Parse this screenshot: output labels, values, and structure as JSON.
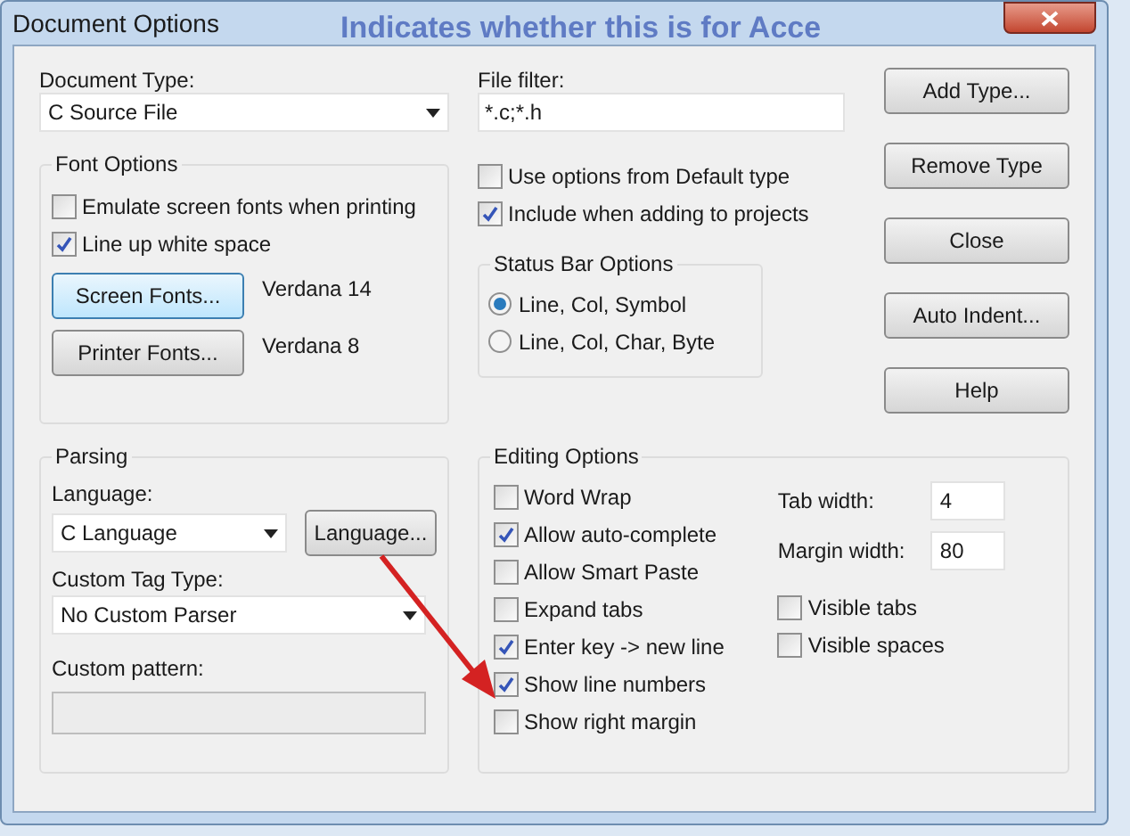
{
  "window": {
    "title": "Document Options",
    "background_text": "Indicates whether this is for Acce"
  },
  "document_type": {
    "label": "Document Type:",
    "value": "C Source File"
  },
  "file_filter": {
    "label": "File filter:",
    "value": "*.c;*.h"
  },
  "font_options": {
    "title": "Font Options",
    "checkboxes": [
      {
        "label": "Emulate screen fonts when printing",
        "checked": false
      },
      {
        "label": "Line up white space",
        "checked": true
      }
    ],
    "fonts": [
      {
        "button": "Screen Fonts...",
        "value": "Verdana 14",
        "focused": true
      },
      {
        "button": "Printer Fonts...",
        "value": "Verdana 8",
        "focused": false
      }
    ]
  },
  "type_options": [
    {
      "label": "Use options from Default type",
      "checked": false
    },
    {
      "label": "Include when adding to projects",
      "checked": true
    }
  ],
  "status_bar_options": {
    "title": "Status Bar Options",
    "options": [
      {
        "label": "Line, Col, Symbol",
        "selected": true
      },
      {
        "label": "Line, Col, Char, Byte",
        "selected": false
      }
    ]
  },
  "buttons": [
    "Add Type...",
    "Remove Type",
    "Close",
    "Auto Indent...",
    "Help"
  ],
  "parsing": {
    "title": "Parsing",
    "language_label": "Language:",
    "language": "C Language",
    "language_button": "Language...",
    "custom_tag_label": "Custom Tag Type:",
    "custom_tag": "No Custom Parser",
    "custom_pattern_label": "Custom pattern:",
    "custom_pattern_disabled": true
  },
  "editing_options": {
    "title": "Editing Options",
    "checkboxes": [
      {
        "label": "Word Wrap",
        "checked": false
      },
      {
        "label": "Allow auto-complete",
        "checked": true
      },
      {
        "label": "Allow Smart Paste",
        "checked": false
      },
      {
        "label": "Expand tabs",
        "checked": false
      },
      {
        "label": "Enter key -> new line",
        "checked": true
      },
      {
        "label": "Show line numbers",
        "checked": true
      },
      {
        "label": "Show right margin",
        "checked": false
      }
    ],
    "fields": [
      {
        "label": "Tab width:",
        "value": "4"
      },
      {
        "label": "Margin width:",
        "value": "80"
      }
    ],
    "visibility": [
      {
        "label": "Visible tabs",
        "checked": false
      },
      {
        "label": "Visible spaces",
        "checked": false
      }
    ]
  }
}
